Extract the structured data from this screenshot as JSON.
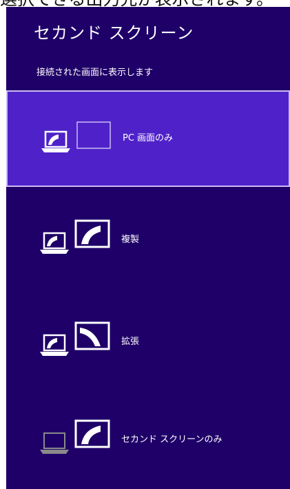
{
  "caption": "選択できる出力先が表示されます。",
  "title": "セカンド スクリーン",
  "subtitle": "接続された画面に表示します",
  "colors": {
    "panel": "#1f0068",
    "selected": "#4f22c9",
    "selected_border": "#cdbdf5"
  },
  "options": [
    {
      "label": "PC 画面のみ",
      "icon": "pc-screen-only-icon",
      "selected": true
    },
    {
      "label": "複製",
      "icon": "duplicate-icon",
      "selected": false
    },
    {
      "label": "拡張",
      "icon": "extend-icon",
      "selected": false
    },
    {
      "label": "セカンド スクリーンのみ",
      "icon": "second-screen-only-icon",
      "selected": false
    }
  ]
}
